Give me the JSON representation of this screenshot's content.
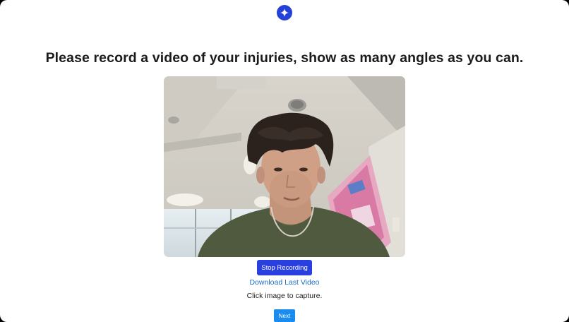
{
  "header": {
    "logo_icon": "sparkle-icon",
    "accent_color": "#2641d8"
  },
  "main": {
    "title": "Please record a video of your injuries, show as many angles as you can.",
    "video": {
      "content": "live-camera-preview"
    },
    "stop_button_label": "Stop Recording",
    "download_link_label": "Download Last Video",
    "capture_hint": "Click image to capture.",
    "next_button_label": "Next"
  },
  "colors": {
    "stop_button": "#2a3fe0",
    "next_button": "#1a8cf0",
    "link": "#1f6fc4"
  }
}
